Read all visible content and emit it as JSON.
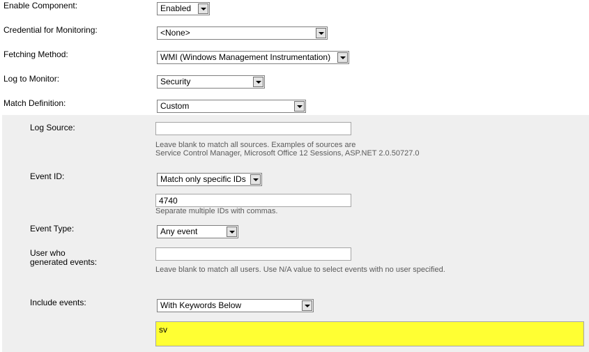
{
  "form": {
    "enable_component": {
      "label": "Enable Component:",
      "value": "Enabled"
    },
    "credential": {
      "label": "Credential for Monitoring:",
      "value": "<None>"
    },
    "fetching_method": {
      "label": "Fetching Method:",
      "value": "WMI (Windows Management Instrumentation)"
    },
    "log_to_monitor": {
      "label": "Log to Monitor:",
      "value": "Security"
    },
    "match_definition": {
      "label": "Match Definition:",
      "value": "Custom"
    }
  },
  "custom": {
    "log_source": {
      "label": "Log Source:",
      "value": "",
      "hint_line1": "Leave blank to match all sources. Examples of sources are",
      "hint_line2": "Service Control Manager, Microsoft Office 12 Sessions, ASP.NET 2.0.50727.0"
    },
    "event_id": {
      "label": "Event ID:",
      "mode": "Match only specific IDs",
      "value": "4740",
      "hint": "Separate multiple IDs with commas."
    },
    "event_type": {
      "label": "Event Type:",
      "value": "Any event"
    },
    "user": {
      "label_line1": "User who",
      "label_line2": "generated events:",
      "value": "",
      "hint": "Leave blank to match all users. Use N/A value to select events with no user specified."
    },
    "include_events": {
      "label": "Include events:",
      "value": "With Keywords Below",
      "keywords": "sv"
    }
  },
  "colors": {
    "panel_background": "#efefef",
    "keywords_highlight": "#ffff33"
  }
}
